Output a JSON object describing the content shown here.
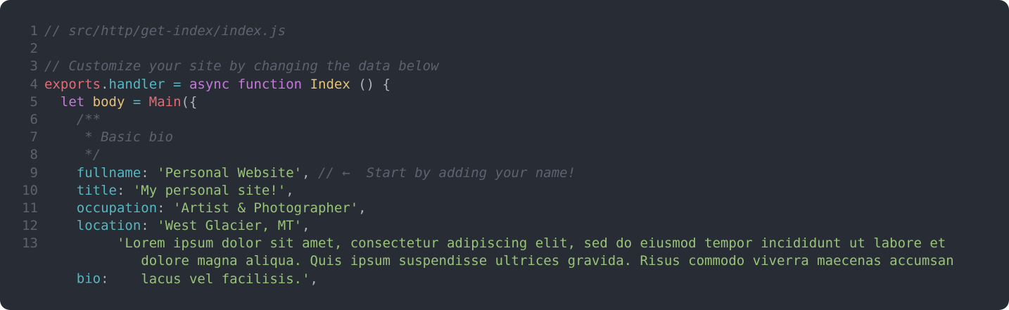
{
  "lines": [
    {
      "num": "1",
      "comment": "// src/http/get-index/index.js"
    },
    {
      "num": "2"
    },
    {
      "num": "3",
      "comment": "// Customize your site by changing the data below"
    },
    {
      "num": "4",
      "exports": "exports",
      "dot": ".",
      "handler": "handler",
      "eq": " = ",
      "async": "async",
      "sp": " ",
      "function": "function",
      "name": "Index",
      "rest": " () {"
    },
    {
      "num": "5",
      "indent": "  ",
      "let": "let",
      "body": "body",
      "eq": " = ",
      "main": "Main",
      "rest": "({"
    },
    {
      "num": "6",
      "indent": "    ",
      "comment": "/**"
    },
    {
      "num": "7",
      "indent": "     ",
      "comment": "* Basic bio"
    },
    {
      "num": "8",
      "indent": "     ",
      "comment": "*/"
    },
    {
      "num": "9",
      "indent": "    ",
      "key": "fullname",
      "colon": ": ",
      "value": "'Personal Website'",
      "comma": ", ",
      "comment": "// ←  Start by adding your name!"
    },
    {
      "num": "10",
      "indent": "    ",
      "key": "title",
      "colon": ": ",
      "value": "'My personal site!'",
      "comma": ","
    },
    {
      "num": "11",
      "indent": "    ",
      "key": "occupation",
      "colon": ": ",
      "value": "'Artist & Photographer'",
      "comma": ","
    },
    {
      "num": "12",
      "indent": "    ",
      "key": "location",
      "colon": ": ",
      "value": "'West Glacier, MT'",
      "comma": ","
    },
    {
      "num": "13",
      "indent": "    ",
      "key": "bio",
      "colon": ": ",
      "value_line1": "'Lorem ipsum dolor sit amet, consectetur adipiscing elit, sed do eiusmod tempor incididunt ut labore et",
      "value_line2": "dolore magna aliqua. Quis ipsum suspendisse ultrices gravida. Risus commodo viverra maecenas accumsan",
      "value_line3": "lacus vel facilisis.'",
      "comma": ","
    }
  ]
}
